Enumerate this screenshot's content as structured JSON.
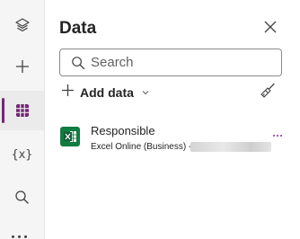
{
  "panel": {
    "title": "Data",
    "search": {
      "placeholder": "Search",
      "value": ""
    },
    "add_data_label": "Add data"
  },
  "data_sources": [
    {
      "name": "Responsible",
      "connector": "Excel Online (Business) - ",
      "icon": "excel-icon"
    }
  ],
  "rail": {
    "items": [
      {
        "icon": "layers-icon"
      },
      {
        "icon": "add-icon"
      },
      {
        "icon": "data-icon",
        "selected": true
      },
      {
        "icon": "variables-icon",
        "label": "{x}"
      },
      {
        "icon": "search-icon"
      },
      {
        "icon": "more-icon"
      }
    ]
  },
  "colors": {
    "accent": "#742774",
    "excel": "#107c41",
    "rail_background": "#f5f5f5"
  }
}
